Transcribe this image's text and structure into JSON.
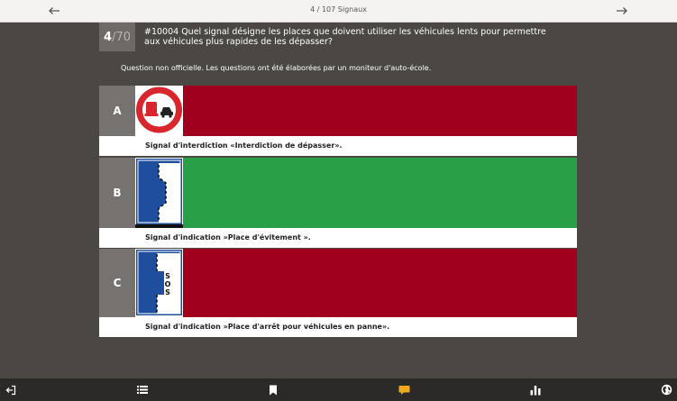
{
  "header": {
    "prev_icon": "arrow-left-icon",
    "counter": "4 / 107 Signaux",
    "next_icon": "arrow-right-icon"
  },
  "question": {
    "current": "4",
    "total": "/70",
    "text": "#10004 Quel signal désigne les places que doivent utiliser les véhicules lents pour permettre aux véhicules plus rapides de les dépasser?",
    "note": "Question non officielle. Les questions ont été élaborées par un moniteur d'auto-école."
  },
  "answers": [
    {
      "letter": "A",
      "caption": "Signal d'interdiction «Interdiction de dépasser».",
      "state": "wrong",
      "color": "#a0001e",
      "sign": "no-overtaking-sign"
    },
    {
      "letter": "B",
      "caption": "Signal d'indication »Place d'évitement ».",
      "state": "correct",
      "color": "#27a048",
      "sign": "passing-place-sign"
    },
    {
      "letter": "C",
      "caption": "Signal d'indication »Place d'arrêt pour véhicules en panne».",
      "state": "wrong",
      "color": "#a0001e",
      "sign": "emergency-stop-sign"
    }
  ],
  "sos_text": "SOS",
  "toolbar": {
    "items": [
      "exit-icon",
      "list-icon",
      "bookmark-icon",
      "comment-icon",
      "stats-icon",
      "globe-icon"
    ],
    "active_color": "#f0a81c"
  }
}
